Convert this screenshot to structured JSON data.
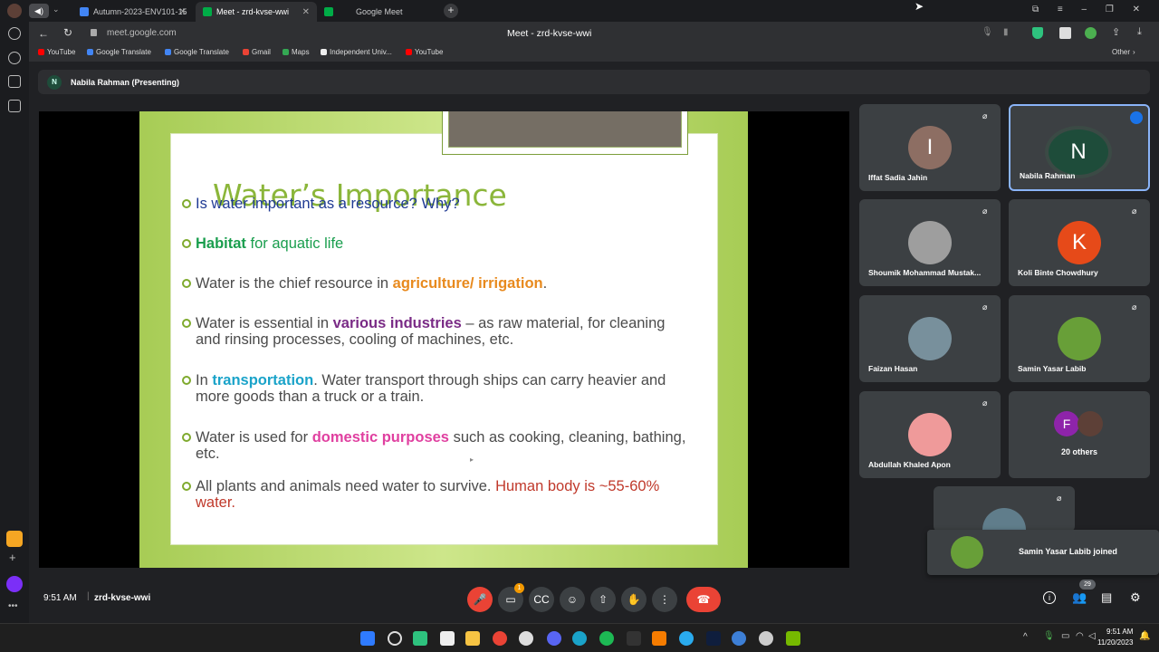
{
  "browser": {
    "tabs": [
      {
        "label": "Autumn-2023-ENV101-15",
        "active": false
      },
      {
        "label": "Meet - zrd-kvse-wwi",
        "active": true
      },
      {
        "label": "Google Meet",
        "active": false
      }
    ],
    "url": "meet.google.com",
    "page_title": "Meet - zrd-kvse-wwi",
    "bookmarks": [
      "YouTube",
      "Google Translate",
      "Google Translate",
      "Gmail",
      "Maps",
      "Independent Univ...",
      "YouTube"
    ],
    "bookmarks_other": "Other"
  },
  "meet": {
    "presenter_initial": "N",
    "presenting_label": "Nabila Rahman (Presenting)",
    "time": "9:51 AM",
    "meeting_code": "zrd-kvse-wwi",
    "participant_count": "29",
    "chat_badge": "1",
    "join_toast": "Samin Yasar Labib joined",
    "participants": [
      {
        "name": "Iffat Sadia Jahin",
        "initial": "I",
        "color": "#8d6e63"
      },
      {
        "name": "Nabila Rahman",
        "initial": "N",
        "color": "#1e4c3a"
      },
      {
        "name": "Shoumik Mohammad Mustak...",
        "initial": "",
        "color": "#9e9e9e"
      },
      {
        "name": "Koli Binte Chowdhury",
        "initial": "K",
        "color": "#e64a19"
      },
      {
        "name": "Faizan Hasan",
        "initial": "",
        "color": "#78909c"
      },
      {
        "name": "Samin Yasar Labib",
        "initial": "",
        "color": "#689f38"
      },
      {
        "name": "Abdullah Khaled Apon",
        "initial": "",
        "color": "#ef9a9a"
      },
      {
        "name": "20 others",
        "initial": "F",
        "color": "#8e24aa"
      }
    ]
  },
  "slide": {
    "title": "Water’s Importance",
    "bullets": [
      {
        "parts": [
          {
            "t": "Is water important as a resource? Why?",
            "c": "blue"
          }
        ]
      },
      {
        "parts": [
          {
            "t": "Habitat",
            "c": "green-b"
          },
          {
            "t": " for aquatic life",
            "c": "green"
          }
        ]
      },
      {
        "parts": [
          {
            "t": "Water is the chief resource in ",
            "c": ""
          },
          {
            "t": "agriculture/ irrigation",
            "c": "orange"
          },
          {
            "t": ".",
            "c": ""
          }
        ]
      },
      {
        "parts": [
          {
            "t": "Water is essential in ",
            "c": ""
          },
          {
            "t": "various industries",
            "c": "purple"
          },
          {
            "t": " – as raw material, for cleaning and rinsing processes, cooling of machines, etc.",
            "c": ""
          }
        ]
      },
      {
        "parts": [
          {
            "t": "In ",
            "c": ""
          },
          {
            "t": "transportation",
            "c": "cyan"
          },
          {
            "t": ". Water transport through ships can carry heavier and more goods than a truck or a train.",
            "c": ""
          }
        ]
      },
      {
        "parts": [
          {
            "t": "Water is used for ",
            "c": ""
          },
          {
            "t": "domestic purposes",
            "c": "pink"
          },
          {
            "t": " such as cooking, cleaning, bathing, etc.",
            "c": ""
          }
        ]
      },
      {
        "parts": [
          {
            "t": "All plants and animals need water to survive. ",
            "c": ""
          },
          {
            "t": "Human body is ~55-60% water.",
            "c": "red"
          }
        ]
      }
    ]
  },
  "taskbar": {
    "time": "9:51 AM",
    "date": "11/20/2023"
  }
}
